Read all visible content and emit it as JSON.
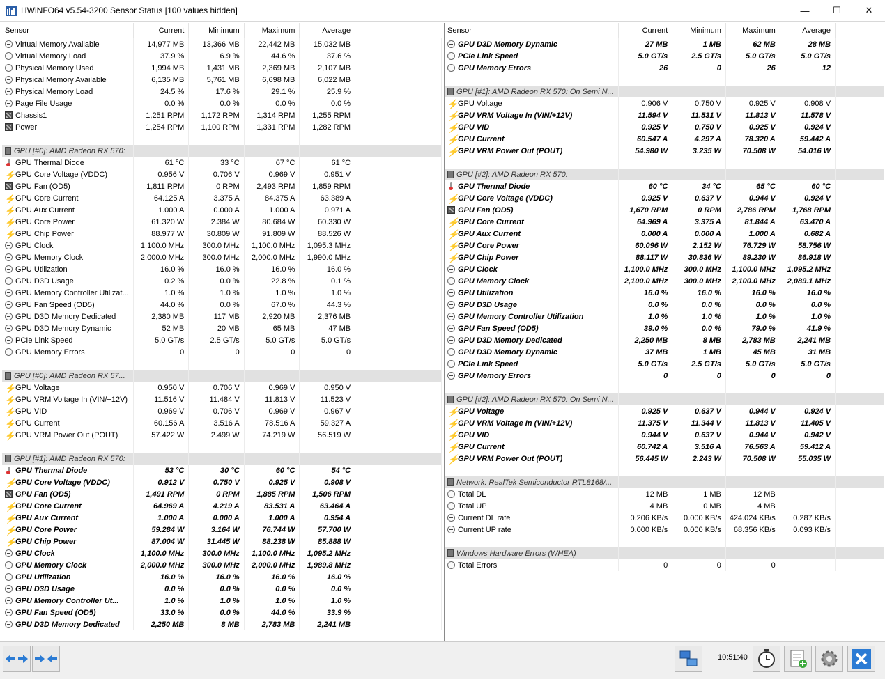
{
  "window": {
    "title": "HWiNFO64 v5.54-3200 Sensor Status [100 values hidden]",
    "minimize": "—",
    "maximize": "☐",
    "close": "✕"
  },
  "columns": [
    "Sensor",
    "Current",
    "Minimum",
    "Maximum",
    "Average"
  ],
  "left_rows": [
    {
      "t": "r",
      "i": "clock",
      "n": "Virtual Memory Available",
      "v": [
        "14,977 MB",
        "13,366 MB",
        "22,442 MB",
        "15,032 MB"
      ]
    },
    {
      "t": "r",
      "i": "clock",
      "n": "Virtual Memory Load",
      "v": [
        "37.9 %",
        "6.9 %",
        "44.6 %",
        "37.6 %"
      ]
    },
    {
      "t": "r",
      "i": "clock",
      "n": "Physical Memory Used",
      "v": [
        "1,994 MB",
        "1,431 MB",
        "2,369 MB",
        "2,107 MB"
      ]
    },
    {
      "t": "r",
      "i": "clock",
      "n": "Physical Memory Available",
      "v": [
        "6,135 MB",
        "5,761 MB",
        "6,698 MB",
        "6,022 MB"
      ]
    },
    {
      "t": "r",
      "i": "clock",
      "n": "Physical Memory Load",
      "v": [
        "24.5 %",
        "17.6 %",
        "29.1 %",
        "25.9 %"
      ]
    },
    {
      "t": "r",
      "i": "clock",
      "n": "Page File Usage",
      "v": [
        "0.0 %",
        "0.0 %",
        "0.0 %",
        "0.0 %"
      ]
    },
    {
      "t": "r",
      "i": "fan",
      "n": "Chassis1",
      "v": [
        "1,251 RPM",
        "1,172 RPM",
        "1,314 RPM",
        "1,255 RPM"
      ]
    },
    {
      "t": "r",
      "i": "fan",
      "n": "Power",
      "v": [
        "1,254 RPM",
        "1,100 RPM",
        "1,331 RPM",
        "1,282 RPM"
      ]
    },
    {
      "t": "gap"
    },
    {
      "t": "g",
      "n": "GPU [#0]: AMD Radeon RX 570:"
    },
    {
      "t": "r",
      "i": "temp",
      "n": "GPU Thermal Diode",
      "v": [
        "61 °C",
        "33 °C",
        "67 °C",
        "61 °C"
      ]
    },
    {
      "t": "r",
      "i": "volt",
      "n": "GPU Core Voltage (VDDC)",
      "v": [
        "0.956 V",
        "0.706 V",
        "0.969 V",
        "0.951 V"
      ]
    },
    {
      "t": "r",
      "i": "fan",
      "n": "GPU Fan (OD5)",
      "v": [
        "1,811 RPM",
        "0 RPM",
        "2,493 RPM",
        "1,859 RPM"
      ]
    },
    {
      "t": "r",
      "i": "volt",
      "n": "GPU Core Current",
      "v": [
        "64.125 A",
        "3.375 A",
        "84.375 A",
        "63.389 A"
      ]
    },
    {
      "t": "r",
      "i": "volt",
      "n": "GPU Aux Current",
      "v": [
        "1.000 A",
        "0.000 A",
        "1.000 A",
        "0.971 A"
      ]
    },
    {
      "t": "r",
      "i": "volt",
      "n": "GPU Core Power",
      "v": [
        "61.320 W",
        "2.384 W",
        "80.684 W",
        "60.330 W"
      ]
    },
    {
      "t": "r",
      "i": "volt",
      "n": "GPU Chip Power",
      "v": [
        "88.977 W",
        "30.809 W",
        "91.809 W",
        "88.526 W"
      ]
    },
    {
      "t": "r",
      "i": "clock",
      "n": "GPU Clock",
      "v": [
        "1,100.0 MHz",
        "300.0 MHz",
        "1,100.0 MHz",
        "1,095.3 MHz"
      ]
    },
    {
      "t": "r",
      "i": "clock",
      "n": "GPU Memory Clock",
      "v": [
        "2,000.0 MHz",
        "300.0 MHz",
        "2,000.0 MHz",
        "1,990.0 MHz"
      ]
    },
    {
      "t": "r",
      "i": "clock",
      "n": "GPU Utilization",
      "v": [
        "16.0 %",
        "16.0 %",
        "16.0 %",
        "16.0 %"
      ]
    },
    {
      "t": "r",
      "i": "clock",
      "n": "GPU D3D Usage",
      "v": [
        "0.2 %",
        "0.0 %",
        "22.8 %",
        "0.1 %"
      ]
    },
    {
      "t": "r",
      "i": "clock",
      "n": "GPU Memory Controller Utilizat...",
      "v": [
        "1.0 %",
        "1.0 %",
        "1.0 %",
        "1.0 %"
      ]
    },
    {
      "t": "r",
      "i": "clock",
      "n": "GPU Fan Speed (OD5)",
      "v": [
        "44.0 %",
        "0.0 %",
        "67.0 %",
        "44.3 %"
      ]
    },
    {
      "t": "r",
      "i": "clock",
      "n": "GPU D3D Memory Dedicated",
      "v": [
        "2,380 MB",
        "117 MB",
        "2,920 MB",
        "2,376 MB"
      ]
    },
    {
      "t": "r",
      "i": "clock",
      "n": "GPU D3D Memory Dynamic",
      "v": [
        "52 MB",
        "20 MB",
        "65 MB",
        "47 MB"
      ]
    },
    {
      "t": "r",
      "i": "clock",
      "n": "PCIe Link Speed",
      "v": [
        "5.0 GT/s",
        "2.5 GT/s",
        "5.0 GT/s",
        "5.0 GT/s"
      ]
    },
    {
      "t": "r",
      "i": "clock",
      "n": "GPU Memory Errors",
      "v": [
        "0",
        "0",
        "0",
        "0"
      ]
    },
    {
      "t": "gap"
    },
    {
      "t": "g",
      "n": "GPU [#0]: AMD Radeon RX 57..."
    },
    {
      "t": "r",
      "i": "volt",
      "n": "GPU Voltage",
      "v": [
        "0.950 V",
        "0.706 V",
        "0.969 V",
        "0.950 V"
      ]
    },
    {
      "t": "r",
      "i": "volt",
      "n": "GPU VRM Voltage In (VIN/+12V)",
      "v": [
        "11.516 V",
        "11.484 V",
        "11.813 V",
        "11.523 V"
      ]
    },
    {
      "t": "r",
      "i": "volt",
      "n": "GPU VID",
      "v": [
        "0.969 V",
        "0.706 V",
        "0.969 V",
        "0.967 V"
      ]
    },
    {
      "t": "r",
      "i": "volt",
      "n": "GPU Current",
      "v": [
        "60.156 A",
        "3.516 A",
        "78.516 A",
        "59.327 A"
      ]
    },
    {
      "t": "r",
      "i": "volt",
      "n": "GPU VRM Power Out (POUT)",
      "v": [
        "57.422 W",
        "2.499 W",
        "74.219 W",
        "56.519 W"
      ]
    },
    {
      "t": "gap"
    },
    {
      "t": "g",
      "n": "GPU [#1]: AMD Radeon RX 570:"
    },
    {
      "t": "r",
      "b": true,
      "i": "temp",
      "n": "GPU Thermal Diode",
      "v": [
        "53 °C",
        "30 °C",
        "60 °C",
        "54 °C"
      ]
    },
    {
      "t": "r",
      "b": true,
      "i": "volt",
      "n": "GPU Core Voltage (VDDC)",
      "v": [
        "0.912 V",
        "0.750 V",
        "0.925 V",
        "0.908 V"
      ]
    },
    {
      "t": "r",
      "b": true,
      "i": "fan",
      "n": "GPU Fan (OD5)",
      "v": [
        "1,491 RPM",
        "0 RPM",
        "1,885 RPM",
        "1,506 RPM"
      ]
    },
    {
      "t": "r",
      "b": true,
      "i": "volt",
      "n": "GPU Core Current",
      "v": [
        "64.969 A",
        "4.219 A",
        "83.531 A",
        "63.464 A"
      ]
    },
    {
      "t": "r",
      "b": true,
      "i": "volt",
      "n": "GPU Aux Current",
      "v": [
        "1.000 A",
        "0.000 A",
        "1.000 A",
        "0.954 A"
      ]
    },
    {
      "t": "r",
      "b": true,
      "i": "volt",
      "n": "GPU Core Power",
      "v": [
        "59.284 W",
        "3.164 W",
        "76.744 W",
        "57.700 W"
      ]
    },
    {
      "t": "r",
      "b": true,
      "i": "volt",
      "n": "GPU Chip Power",
      "v": [
        "87.004 W",
        "31.445 W",
        "88.238 W",
        "85.888 W"
      ]
    },
    {
      "t": "r",
      "b": true,
      "i": "clock",
      "n": "GPU Clock",
      "v": [
        "1,100.0 MHz",
        "300.0 MHz",
        "1,100.0 MHz",
        "1,095.2 MHz"
      ]
    },
    {
      "t": "r",
      "b": true,
      "i": "clock",
      "n": "GPU Memory Clock",
      "v": [
        "2,000.0 MHz",
        "300.0 MHz",
        "2,000.0 MHz",
        "1,989.8 MHz"
      ]
    },
    {
      "t": "r",
      "b": true,
      "i": "clock",
      "n": "GPU Utilization",
      "v": [
        "16.0 %",
        "16.0 %",
        "16.0 %",
        "16.0 %"
      ]
    },
    {
      "t": "r",
      "b": true,
      "i": "clock",
      "n": "GPU D3D Usage",
      "v": [
        "0.0 %",
        "0.0 %",
        "0.0 %",
        "0.0 %"
      ]
    },
    {
      "t": "r",
      "b": true,
      "i": "clock",
      "n": "GPU Memory Controller Ut...",
      "v": [
        "1.0 %",
        "1.0 %",
        "1.0 %",
        "1.0 %"
      ]
    },
    {
      "t": "r",
      "b": true,
      "i": "clock",
      "n": "GPU Fan Speed (OD5)",
      "v": [
        "33.0 %",
        "0.0 %",
        "44.0 %",
        "33.9 %"
      ]
    },
    {
      "t": "r",
      "b": true,
      "i": "clock",
      "n": "GPU D3D Memory Dedicated",
      "v": [
        "2,250 MB",
        "8 MB",
        "2,783 MB",
        "2,241 MB"
      ]
    }
  ],
  "right_rows": [
    {
      "t": "r",
      "b": true,
      "i": "clock",
      "n": "GPU D3D Memory Dynamic",
      "v": [
        "27 MB",
        "1 MB",
        "62 MB",
        "28 MB"
      ]
    },
    {
      "t": "r",
      "b": true,
      "i": "clock",
      "n": "PCIe Link Speed",
      "v": [
        "5.0 GT/s",
        "2.5 GT/s",
        "5.0 GT/s",
        "5.0 GT/s"
      ]
    },
    {
      "t": "r",
      "b": true,
      "i": "clock",
      "n": "GPU Memory Errors",
      "v": [
        "26",
        "0",
        "26",
        "12"
      ]
    },
    {
      "t": "gap"
    },
    {
      "t": "g",
      "n": "GPU [#1]: AMD Radeon RX 570: On Semi N..."
    },
    {
      "t": "r",
      "bo": true,
      "i": "volt",
      "n": "GPU Voltage",
      "v": [
        "0.906 V",
        "0.750 V",
        "0.925 V",
        "0.908 V"
      ]
    },
    {
      "t": "r",
      "b": true,
      "i": "volt",
      "n": "GPU VRM Voltage In (VIN/+12V)",
      "v": [
        "11.594 V",
        "11.531 V",
        "11.813 V",
        "11.578 V"
      ]
    },
    {
      "t": "r",
      "b": true,
      "i": "volt",
      "n": "GPU VID",
      "v": [
        "0.925 V",
        "0.750 V",
        "0.925 V",
        "0.924 V"
      ]
    },
    {
      "t": "r",
      "b": true,
      "i": "volt",
      "n": "GPU Current",
      "v": [
        "60.547 A",
        "4.297 A",
        "78.320 A",
        "59.442 A"
      ]
    },
    {
      "t": "r",
      "b": true,
      "i": "volt",
      "n": "GPU VRM Power Out (POUT)",
      "v": [
        "54.980 W",
        "3.235 W",
        "70.508 W",
        "54.016 W"
      ]
    },
    {
      "t": "gap"
    },
    {
      "t": "g",
      "n": "GPU [#2]: AMD Radeon RX 570:"
    },
    {
      "t": "r",
      "b": true,
      "i": "temp",
      "n": "GPU Thermal Diode",
      "v": [
        "60 °C",
        "34 °C",
        "65 °C",
        "60 °C"
      ]
    },
    {
      "t": "r",
      "b": true,
      "i": "volt",
      "n": "GPU Core Voltage (VDDC)",
      "v": [
        "0.925 V",
        "0.637 V",
        "0.944 V",
        "0.924 V"
      ]
    },
    {
      "t": "r",
      "b": true,
      "i": "fan",
      "n": "GPU Fan (OD5)",
      "v": [
        "1,670 RPM",
        "0 RPM",
        "2,786 RPM",
        "1,768 RPM"
      ]
    },
    {
      "t": "r",
      "b": true,
      "i": "volt",
      "n": "GPU Core Current",
      "v": [
        "64.969 A",
        "3.375 A",
        "81.844 A",
        "63.470 A"
      ]
    },
    {
      "t": "r",
      "b": true,
      "i": "volt",
      "n": "GPU Aux Current",
      "v": [
        "0.000 A",
        "0.000 A",
        "1.000 A",
        "0.682 A"
      ]
    },
    {
      "t": "r",
      "b": true,
      "i": "volt",
      "n": "GPU Core Power",
      "v": [
        "60.096 W",
        "2.152 W",
        "76.729 W",
        "58.756 W"
      ]
    },
    {
      "t": "r",
      "b": true,
      "i": "volt",
      "n": "GPU Chip Power",
      "v": [
        "88.117 W",
        "30.836 W",
        "89.230 W",
        "86.918 W"
      ]
    },
    {
      "t": "r",
      "b": true,
      "i": "clock",
      "n": "GPU Clock",
      "v": [
        "1,100.0 MHz",
        "300.0 MHz",
        "1,100.0 MHz",
        "1,095.2 MHz"
      ]
    },
    {
      "t": "r",
      "b": true,
      "i": "clock",
      "n": "GPU Memory Clock",
      "v": [
        "2,100.0 MHz",
        "300.0 MHz",
        "2,100.0 MHz",
        "2,089.1 MHz"
      ]
    },
    {
      "t": "r",
      "b": true,
      "i": "clock",
      "n": "GPU Utilization",
      "v": [
        "16.0 %",
        "16.0 %",
        "16.0 %",
        "16.0 %"
      ]
    },
    {
      "t": "r",
      "b": true,
      "i": "clock",
      "n": "GPU D3D Usage",
      "v": [
        "0.0 %",
        "0.0 %",
        "0.0 %",
        "0.0 %"
      ]
    },
    {
      "t": "r",
      "b": true,
      "i": "clock",
      "n": "GPU Memory Controller Utilization",
      "v": [
        "1.0 %",
        "1.0 %",
        "1.0 %",
        "1.0 %"
      ]
    },
    {
      "t": "r",
      "b": true,
      "i": "clock",
      "n": "GPU Fan Speed (OD5)",
      "v": [
        "39.0 %",
        "0.0 %",
        "79.0 %",
        "41.9 %"
      ]
    },
    {
      "t": "r",
      "b": true,
      "i": "clock",
      "n": "GPU D3D Memory Dedicated",
      "v": [
        "2,250 MB",
        "8 MB",
        "2,783 MB",
        "2,241 MB"
      ]
    },
    {
      "t": "r",
      "b": true,
      "i": "clock",
      "n": "GPU D3D Memory Dynamic",
      "v": [
        "37 MB",
        "1 MB",
        "45 MB",
        "31 MB"
      ]
    },
    {
      "t": "r",
      "b": true,
      "i": "clock",
      "n": "PCIe Link Speed",
      "v": [
        "5.0 GT/s",
        "2.5 GT/s",
        "5.0 GT/s",
        "5.0 GT/s"
      ]
    },
    {
      "t": "r",
      "b": true,
      "i": "clock",
      "n": "GPU Memory Errors",
      "v": [
        "0",
        "0",
        "0",
        "0"
      ]
    },
    {
      "t": "gap"
    },
    {
      "t": "g",
      "n": "GPU [#2]: AMD Radeon RX 570: On Semi N..."
    },
    {
      "t": "r",
      "b": true,
      "i": "volt",
      "n": "GPU Voltage",
      "v": [
        "0.925 V",
        "0.637 V",
        "0.944 V",
        "0.924 V"
      ]
    },
    {
      "t": "r",
      "b": true,
      "i": "volt",
      "n": "GPU VRM Voltage In (VIN/+12V)",
      "v": [
        "11.375 V",
        "11.344 V",
        "11.813 V",
        "11.405 V"
      ]
    },
    {
      "t": "r",
      "b": true,
      "i": "volt",
      "n": "GPU VID",
      "v": [
        "0.944 V",
        "0.637 V",
        "0.944 V",
        "0.942 V"
      ]
    },
    {
      "t": "r",
      "b": true,
      "i": "volt",
      "n": "GPU Current",
      "v": [
        "60.742 A",
        "3.516 A",
        "76.563 A",
        "59.412 A"
      ]
    },
    {
      "t": "r",
      "b": true,
      "i": "volt",
      "n": "GPU VRM Power Out (POUT)",
      "v": [
        "56.445 W",
        "2.243 W",
        "70.508 W",
        "55.035 W"
      ]
    },
    {
      "t": "gap"
    },
    {
      "t": "g",
      "n": "Network: RealTek Semiconductor RTL8168/..."
    },
    {
      "t": "r",
      "i": "clock",
      "n": "Total DL",
      "v": [
        "12 MB",
        "1 MB",
        "12 MB",
        ""
      ]
    },
    {
      "t": "r",
      "i": "clock",
      "n": "Total UP",
      "v": [
        "4 MB",
        "0 MB",
        "4 MB",
        ""
      ]
    },
    {
      "t": "r",
      "i": "clock",
      "n": "Current DL rate",
      "v": [
        "0.206 KB/s",
        "0.000 KB/s",
        "424.024 KB/s",
        "0.287 KB/s"
      ]
    },
    {
      "t": "r",
      "i": "clock",
      "n": "Current UP rate",
      "v": [
        "0.000 KB/s",
        "0.000 KB/s",
        "68.356 KB/s",
        "0.093 KB/s"
      ]
    },
    {
      "t": "gap"
    },
    {
      "t": "g",
      "n": "Windows Hardware Errors (WHEA)"
    },
    {
      "t": "r",
      "i": "clock",
      "n": "Total Errors",
      "v": [
        "0",
        "0",
        "0",
        ""
      ]
    }
  ],
  "footer": {
    "time": "10:51:40",
    "nav_left_icon": "double-arrow-icon",
    "nav_right_icon": "collapse-arrows-icon"
  },
  "colors": {
    "group_bg": "#e1e1e1",
    "accent_blue": "#2b7bd4",
    "voltage_icon": "#e8b000"
  }
}
